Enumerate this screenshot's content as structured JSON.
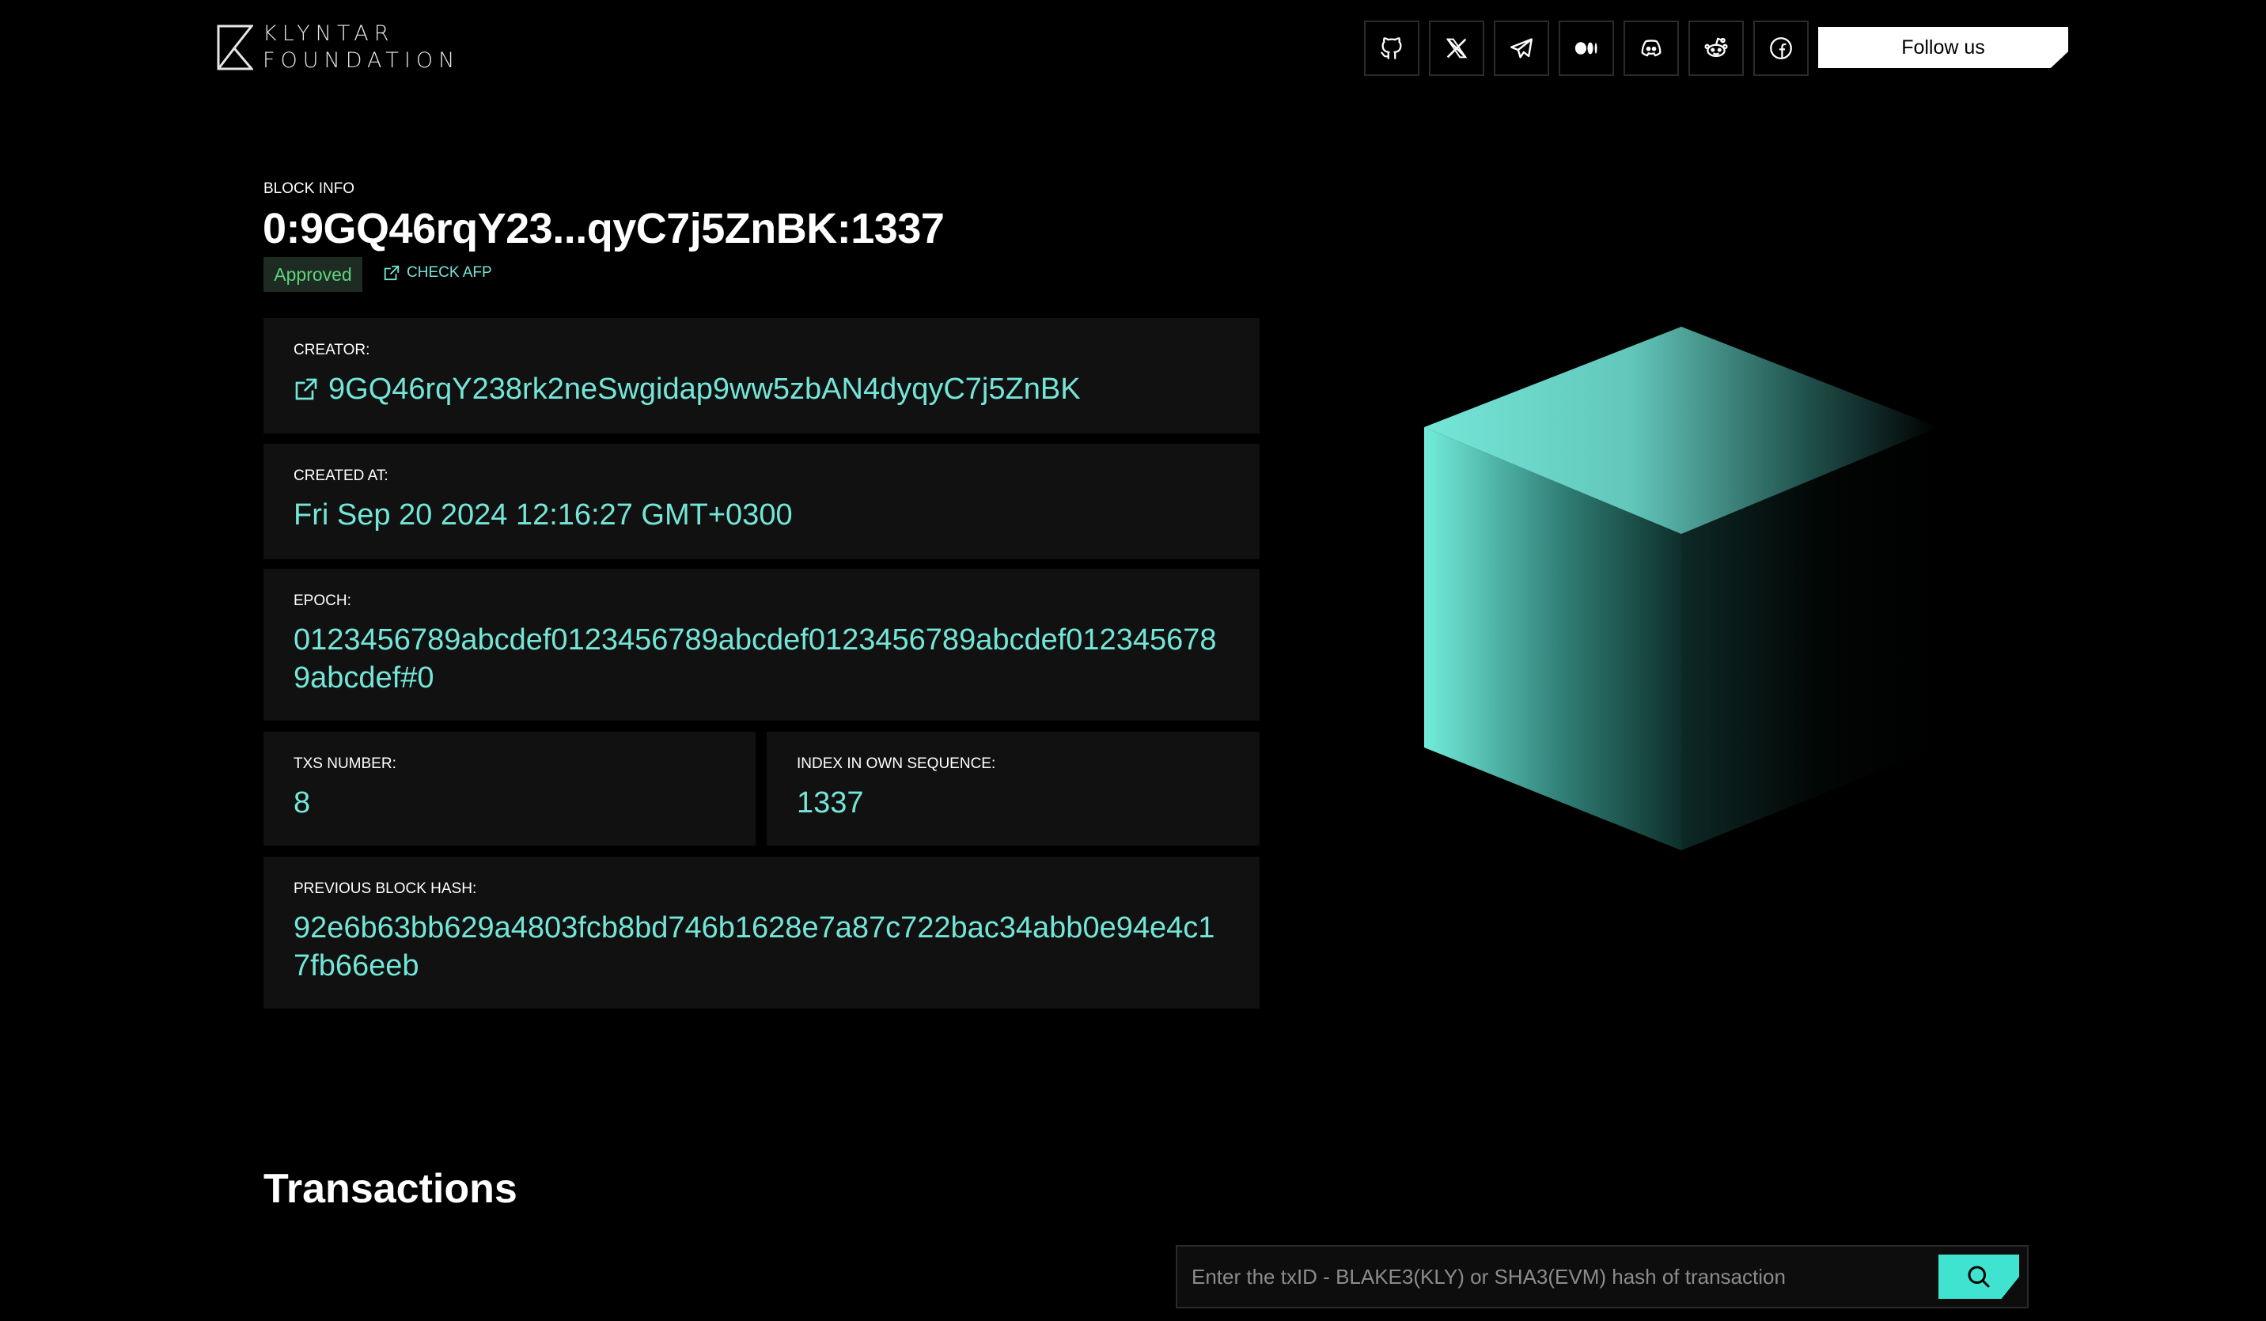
{
  "header": {
    "logo_line1": "KLYNTAR",
    "logo_line2": "FOUNDATION",
    "follow_label": "Follow us",
    "socials": [
      "github-icon",
      "x-icon",
      "telegram-icon",
      "medium-icon",
      "discord-icon",
      "reddit-icon",
      "facebook-icon"
    ]
  },
  "block": {
    "overline": "BLOCK INFO",
    "title": "0:9GQ46rqY23...qyC7j5ZnBK:1337",
    "status": "Approved",
    "check_afp_label": "CHECK AFP"
  },
  "cards": {
    "creator_label": "CREATOR:",
    "creator_value": "9GQ46rqY238rk2neSwgidap9ww5zbAN4dyqyC7j5ZnBK",
    "created_at_label": "CREATED AT:",
    "created_at_value": "Fri Sep 20 2024 12:16:27 GMT+0300",
    "epoch_label": "EPOCH:",
    "epoch_value": "0123456789abcdef0123456789abcdef0123456789abcdef0123456789abcdef#0",
    "txs_label": "TXS NUMBER:",
    "txs_value": "8",
    "index_label": "INDEX IN OWN SEQUENCE:",
    "index_value": "1337",
    "prev_hash_label": "PREVIOUS BLOCK HASH:",
    "prev_hash_value": "92e6b63bb629a4803fcb8bd746b1628e7a87c722bac34abb0e94e4c17fb66eeb"
  },
  "transactions": {
    "title": "Transactions",
    "search_placeholder": "Enter the txID - BLAKE3(KLY) or SHA3(EVM) hash of transaction"
  },
  "colors": {
    "accent": "#74e6d8",
    "approved": "#5fd37a",
    "card_bg": "#111111",
    "search_button": "#3fe3cf"
  }
}
